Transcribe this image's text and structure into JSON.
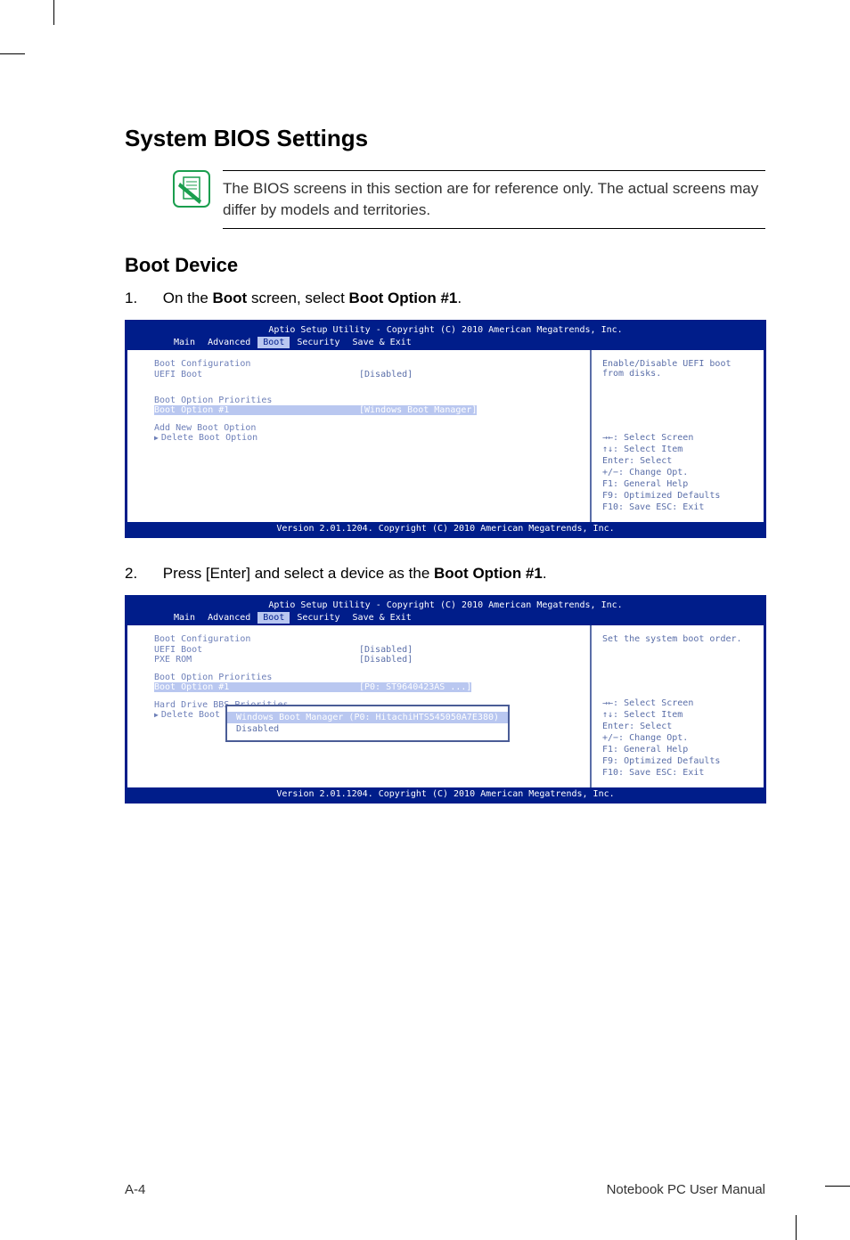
{
  "heading": "System BIOS Settings",
  "note": "The BIOS screens in this section are for reference only. The actual screens may differ by models and territories.",
  "subheading": "Boot Device",
  "step1_num": "1.",
  "step1_prefix": "On the ",
  "step1_bold1": "Boot",
  "step1_mid": " screen, select ",
  "step1_bold2": "Boot Option #1",
  "step1_suffix": ".",
  "step2_num": "2.",
  "step2_prefix": "Press [Enter] and select a device as the ",
  "step2_bold": "Boot Option #1",
  "step2_suffix": ".",
  "bios_header": "Aptio Setup Utility - Copyright (C) 2010 American Megatrends, Inc.",
  "bios_footer": "Version 2.01.1204. Copyright (C) 2010 American Megatrends, Inc.",
  "tabs": {
    "main": "Main",
    "advanced": "Advanced",
    "boot": "Boot",
    "security": "Security",
    "save": "Save & Exit"
  },
  "bios1": {
    "boot_config": "Boot Configuration",
    "uefi_boot": "UEFI Boot",
    "uefi_val": "[Disabled]",
    "priorities": "Boot Option Priorities",
    "opt1": "Boot Option #1",
    "opt1_val": "[Windows Boot Manager]",
    "add": "Add New Boot Option",
    "del": "Delete Boot Option",
    "help": "Enable/Disable UEFI boot from disks.",
    "keys": {
      "k1": "→←: Select Screen",
      "k2": "↑↓:   Select Item",
      "k3": "Enter: Select",
      "k4": "+/−:  Change Opt.",
      "k5": "F1:   General Help",
      "k6": "F9:   Optimized Defaults",
      "k7": "F10:  Save   ESC: Exit"
    }
  },
  "bios2": {
    "boot_config": "Boot Configuration",
    "uefi_boot": "UEFI Boot",
    "uefi_val": "[Disabled]",
    "pxe": "PXE ROM",
    "pxe_val": "[Disabled]",
    "priorities": "Boot Option Priorities",
    "opt1": "Boot Option #1",
    "opt1_val": "[P0: ST9640423AS  ...]",
    "hdd": "Hard Drive BBS Priorities",
    "del": "Delete Boot Option",
    "help": "Set the system boot order.",
    "popup": {
      "item1": "Windows Boot Manager (P0: HitachiHTS545050A7E380)",
      "item2": "Disabled"
    },
    "keys": {
      "k1": "→←: Select Screen",
      "k2": "↑↓:   Select Item",
      "k3": "Enter: Select",
      "k4": "+/−:  Change Opt.",
      "k5": "F1:   General Help",
      "k6": "F9:   Optimized Defaults",
      "k7": "F10:  Save   ESC: Exit"
    }
  },
  "footer": {
    "left": "A-4",
    "right": "Notebook PC User Manual"
  }
}
